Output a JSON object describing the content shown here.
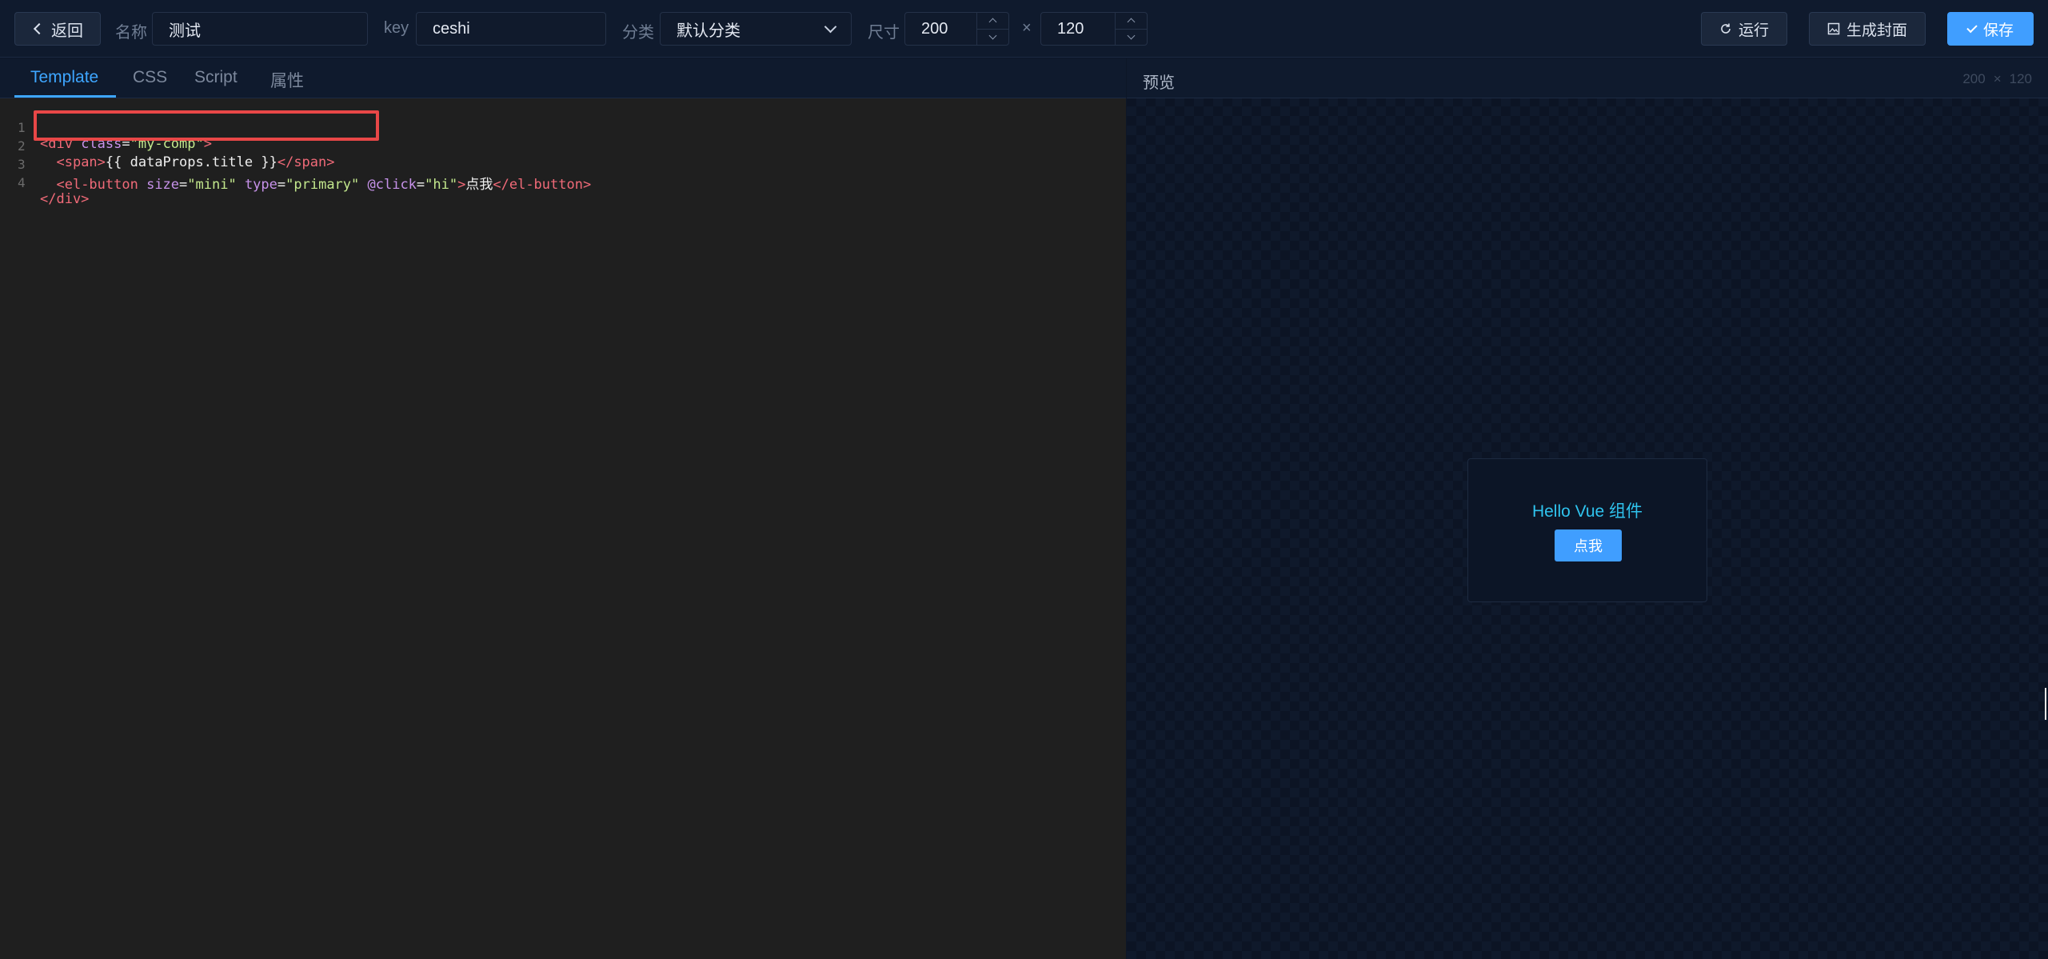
{
  "topbar": {
    "back_label": "返回",
    "name_label": "名称",
    "name_value": "测试",
    "key_label": "key",
    "key_value": "ceshi",
    "category_label": "分类",
    "category_value": "默认分类",
    "size_label": "尺寸",
    "width_value": "200",
    "size_separator": "×",
    "height_value": "120",
    "run_label": "运行",
    "cover_label": "生成封面",
    "save_label": "保存"
  },
  "tabs": [
    {
      "label": "Template",
      "active": true
    },
    {
      "label": "CSS",
      "active": false
    },
    {
      "label": "Script",
      "active": false
    },
    {
      "label": "属性",
      "active": false
    }
  ],
  "editor": {
    "lines": [
      {
        "n": "1"
      },
      {
        "n": "2"
      },
      {
        "n": "3"
      },
      {
        "n": "4"
      }
    ],
    "l1": {
      "open": "<div",
      "attr": " class",
      "eq": "=",
      "str": "\"my-comp\"",
      "close": ">"
    },
    "l2": {
      "indent": "  ",
      "open": "<span>",
      "expr": "{{ dataProps.title }}",
      "close": "</span>"
    },
    "l3": {
      "indent": "  ",
      "open": "<el-button",
      "a1": " size",
      "eq1": "=",
      "s1": "\"mini\"",
      "a2": " type",
      "eq2": "=",
      "s2": "\"primary\"",
      "a3": " @click",
      "eq3": "=",
      "s3": "\"hi\"",
      "gt": ">",
      "text": "点我",
      "close": "</el-button>"
    },
    "l4": {
      "close": "</div>"
    }
  },
  "preview": {
    "title": "预览",
    "width": "200",
    "separator": "×",
    "height": "120",
    "component_title": "Hello Vue 组件",
    "component_button": "点我"
  },
  "colors": {
    "accent": "#409eff",
    "tab_active": "#3ea6ff",
    "highlight": "#e84747",
    "preview_text": "#2fc3ee"
  },
  "icons": [
    "chevron-left-icon",
    "chevron-down-icon",
    "refresh-icon",
    "image-icon",
    "check-icon"
  ]
}
